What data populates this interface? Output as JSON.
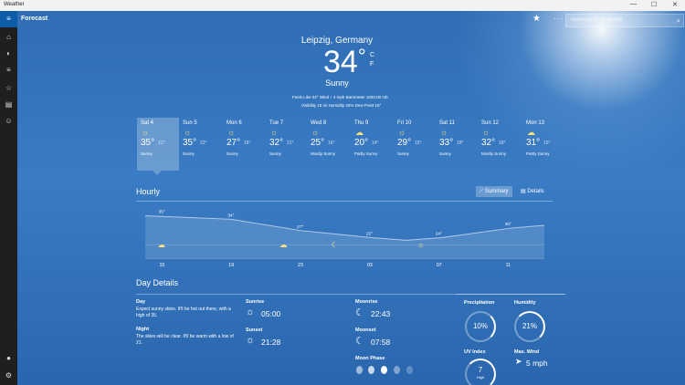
{
  "window": {
    "title": "Weather",
    "buttons": [
      "—",
      "☐",
      "✕"
    ]
  },
  "sidebar": {
    "items": [
      {
        "name": "hamburger",
        "glyph": "≡"
      },
      {
        "name": "forecast",
        "glyph": "⌂"
      },
      {
        "name": "maps",
        "glyph": "◐"
      },
      {
        "name": "historical",
        "glyph": "≡"
      },
      {
        "name": "places",
        "glyph": "☆"
      },
      {
        "name": "news",
        "glyph": "▤"
      },
      {
        "name": "life",
        "glyph": "☺"
      }
    ],
    "bottom": [
      {
        "name": "account",
        "glyph": "●"
      },
      {
        "name": "settings",
        "glyph": "⚙"
      }
    ]
  },
  "topbar": {
    "page": "Forecast",
    "search_placeholder": "Town/city or postcode",
    "more": "···"
  },
  "current": {
    "city": "Leipzig, Germany",
    "temp": "34",
    "deg": "°",
    "unit_c": "C",
    "unit_f": "F",
    "condition": "Sunny",
    "line1": "Feels Like  34°      Wind  ↑  4 mph      Barometer  1020.00 mb",
    "line2": "Visibility  15 mi      Humidity  34%      Dew Point  16°"
  },
  "forecast": [
    {
      "day": "Sat 4",
      "hi": "35°",
      "lo": "21°",
      "cond": "Sunny",
      "icon": "☼"
    },
    {
      "day": "Sun 5",
      "hi": "35°",
      "lo": "22°",
      "cond": "Sunny",
      "icon": "☼"
    },
    {
      "day": "Mon 6",
      "hi": "27°",
      "lo": "16°",
      "cond": "Sunny",
      "icon": "☼"
    },
    {
      "day": "Tue 7",
      "hi": "32°",
      "lo": "21°",
      "cond": "Sunny",
      "icon": "☼"
    },
    {
      "day": "Wed 8",
      "hi": "25°",
      "lo": "16°",
      "cond": "Mostly Sunny",
      "icon": "☼"
    },
    {
      "day": "Thu 9",
      "hi": "20°",
      "lo": "14°",
      "cond": "Partly Sunny",
      "icon": "☁"
    },
    {
      "day": "Fri 10",
      "hi": "29°",
      "lo": "15°",
      "cond": "Sunny",
      "icon": "☼"
    },
    {
      "day": "Sat 11",
      "hi": "33°",
      "lo": "18°",
      "cond": "Sunny",
      "icon": "☼"
    },
    {
      "day": "Sun 12",
      "hi": "32°",
      "lo": "18°",
      "cond": "Mostly Sunny",
      "icon": "☼"
    },
    {
      "day": "Mon 13",
      "hi": "31°",
      "lo": "15°",
      "cond": "Partly Sunny",
      "icon": "☁"
    }
  ],
  "hourly": {
    "title": "Hourly",
    "summary_label": "Summary",
    "details_label": "Details",
    "temps": [
      "35°",
      "34°",
      "27°",
      "22°",
      "24°",
      "30°"
    ],
    "times": [
      "15",
      "19",
      "23",
      "03",
      "07",
      "11"
    ]
  },
  "day_details": {
    "title": "Day Details",
    "day_label": "Day",
    "day_text": "Expect sunny skies. It'll be hot out there, with a high of 35.",
    "night_label": "Night",
    "night_text": "The skies will be clear. It'll be warm with a low of 21.",
    "sunrise_label": "Sunrise",
    "sunrise": "05:00",
    "sunset_label": "Sunset",
    "sunset": "21:28",
    "moonrise_label": "Moonrise",
    "moonrise": "22:43",
    "moonset_label": "Moonset",
    "moonset": "07:58",
    "moonphase_label": "Moon Phase",
    "precip_label": "Precipitation",
    "precip": "10%",
    "humidity_label": "Humidity",
    "humidity": "21%",
    "uv_label": "UV Index",
    "uv": "7",
    "uv_level": "High",
    "wind_label": "Max. Wind",
    "wind": "5 mph"
  },
  "colors": {
    "accent": "#0d5ca8",
    "sun": "#ffe37a"
  }
}
